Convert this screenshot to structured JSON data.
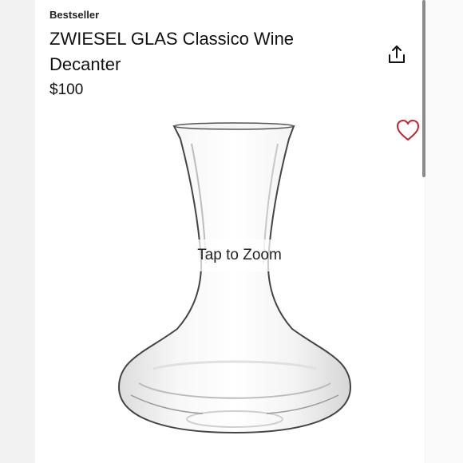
{
  "product": {
    "badge": "Bestseller",
    "title": "ZWIESEL GLAS Classico Wine Decanter",
    "price": "$100"
  },
  "image": {
    "zoom_hint": "Tap to Zoom"
  },
  "actions": {
    "share_icon": "share-upload-icon",
    "favorite_icon": "heart-outline-icon"
  },
  "colors": {
    "favorite_accent": "#c0262d",
    "text": "#111111"
  }
}
